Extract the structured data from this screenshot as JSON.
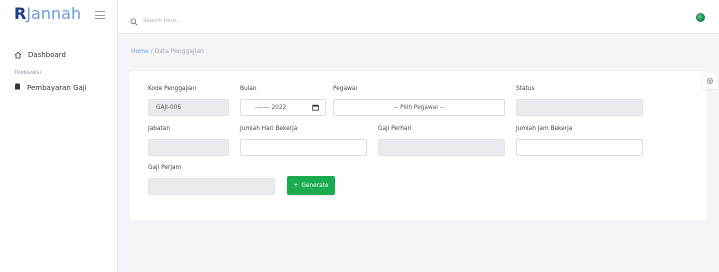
{
  "brand": {
    "part1": "R",
    "part2": "Jannah"
  },
  "sidebar": {
    "dashboard_label": "Dashboard",
    "section_label": "TRANSAKSI",
    "gaji_label": "Pembayaran Gaji"
  },
  "search": {
    "placeholder": "Search here..."
  },
  "breadcrumb": {
    "home": "Home",
    "separator": " / ",
    "current": "Data Penggajian"
  },
  "form": {
    "kode_label": "Kode Penggajian",
    "kode_value": "GAJI-006",
    "bulan_label": "Bulan",
    "bulan_value": "------- 2022",
    "pegawai_label": "Pegawai",
    "pegawai_value": "-- Pilih Pegawai --",
    "status_label": "Status",
    "status_value": "",
    "jabatan_label": "Jabatan",
    "jabatan_value": "",
    "hari_label": "Jumlah Hari Bekerja",
    "hari_value": "",
    "gaji_perhari_label": "Gaji Perhari",
    "gaji_perhari_value": "",
    "jam_label": "Jumlah Jam Bekerja",
    "jam_value": "",
    "gaji_perjam_label": "Gaji Perjam",
    "gaji_perjam_value": "",
    "generate_label": "Generate",
    "generate_icon": "+"
  },
  "colors": {
    "brand_dark": "#1f3a8a",
    "brand_light": "#6c9be0",
    "generate_green": "#1aab4f",
    "disabled_bg": "#e9ebee"
  },
  "icons": [
    "hamburger-icon",
    "home-icon",
    "wallet-icon",
    "search-icon",
    "calendar-icon",
    "gear-icon",
    "avatar"
  ]
}
